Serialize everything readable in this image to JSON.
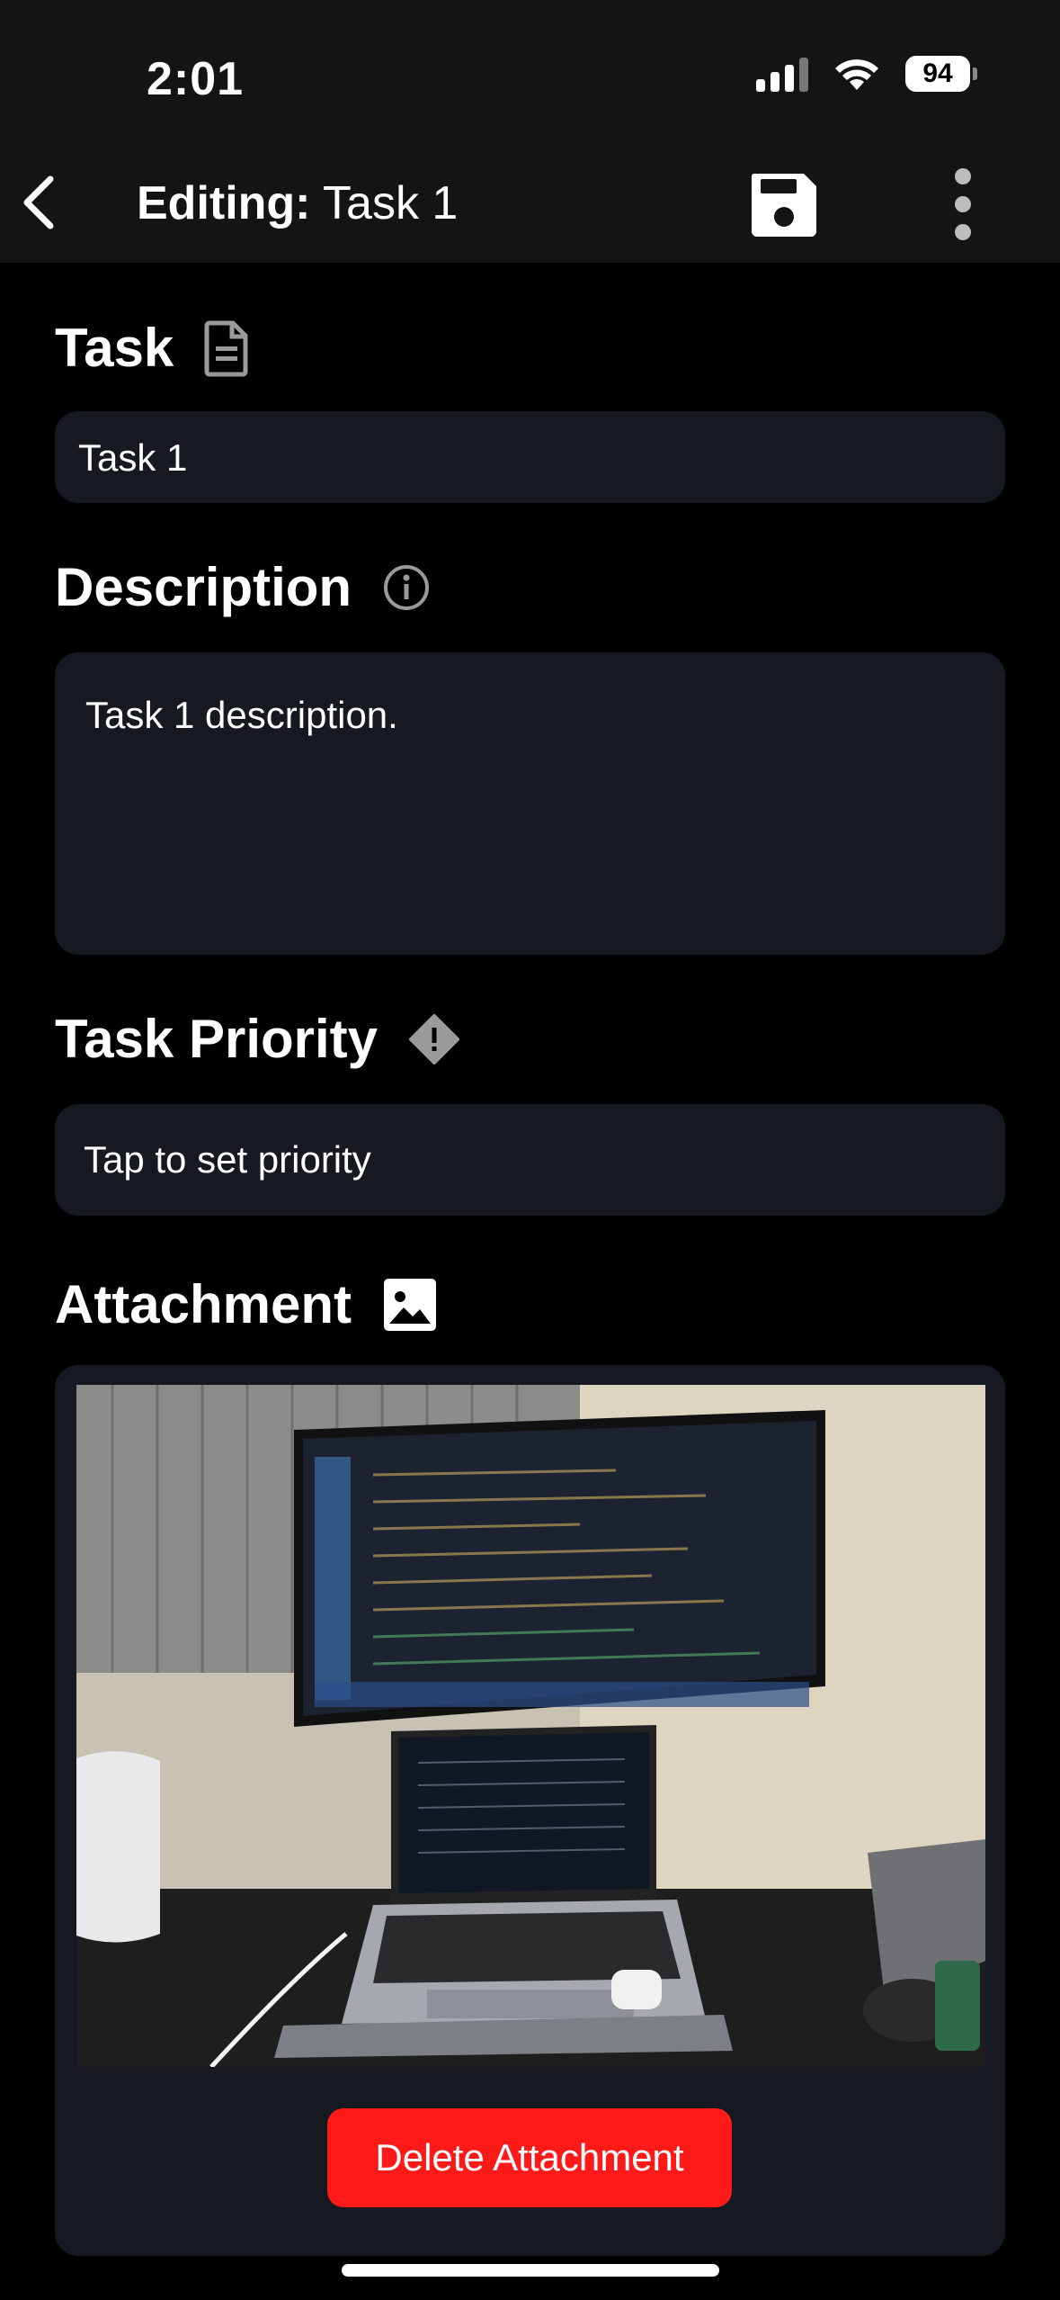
{
  "status_bar": {
    "time": "2:01",
    "battery": "94"
  },
  "app_bar": {
    "title_prefix": "Editing:",
    "title_value": "Task 1"
  },
  "task": {
    "label": "Task",
    "value": "Task 1"
  },
  "description": {
    "label": "Description",
    "value": "Task 1 description."
  },
  "priority": {
    "label": "Task Priority",
    "placeholder": "Tap to set priority"
  },
  "attachment": {
    "label": "Attachment",
    "delete_label": "Delete Attachment"
  },
  "colors": {
    "background": "#000000",
    "header": "#141414",
    "field": "#161a20",
    "danger": "#ff1a1a"
  }
}
